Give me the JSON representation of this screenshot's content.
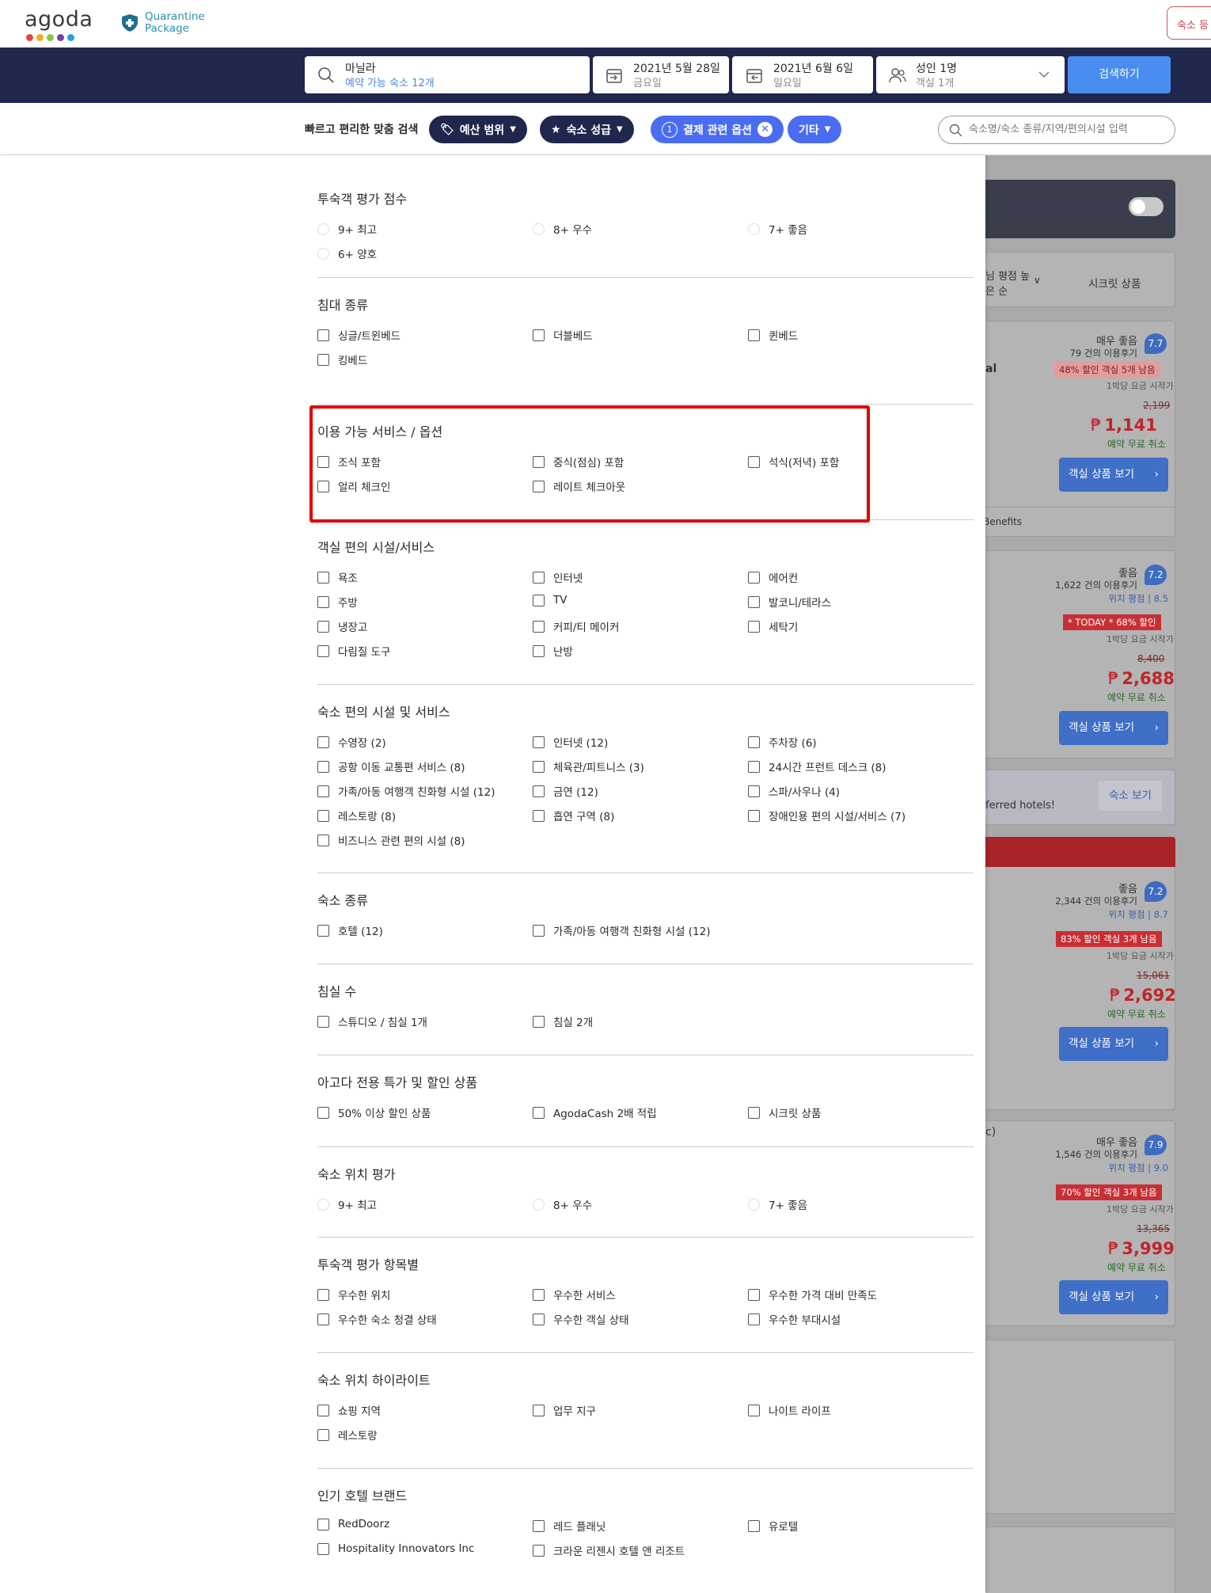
{
  "header": {
    "logo_text": "agoda",
    "logo_dots": [
      "#e64545",
      "#f2a91e",
      "#8cc63e",
      "#7b3fa0",
      "#2a9fd8"
    ],
    "qp_line1": "Quarantine",
    "qp_line2": "Package",
    "list_property": "숙소 등"
  },
  "search": {
    "dest": "마닐라",
    "dest_sub": "예약 가능 숙소 12개",
    "checkin": "2021년 5월 28일",
    "checkin_day": "금요일",
    "checkout": "2021년 6월 6일",
    "checkout_day": "일요일",
    "guests": "성인 1명",
    "rooms": "객실 1개",
    "button": "검색하기"
  },
  "filterbar": {
    "label": "빠르고 편리한 맞춤 검색",
    "budget": "예산 범위",
    "star": "숙소 성급",
    "payment_count": "1",
    "payment": "결제 관련 옵션",
    "other": "기타",
    "placeholder": "숙소명/숙소 종류/지역/편의시설 입력"
  },
  "sections": [
    {
      "title": "투숙객 평가 점수",
      "type": "radio",
      "options": [
        [
          "9+  최고",
          "8+  우수",
          "7+  좋음"
        ],
        [
          "6+  양호"
        ]
      ]
    },
    {
      "title": "침대 종류",
      "type": "check",
      "options": [
        [
          "싱글/트윈베드",
          "더블베드",
          "퀸베드"
        ],
        [
          "킹베드"
        ]
      ]
    },
    {
      "title": "이용 가능 서비스 / 옵션",
      "type": "check",
      "options": [
        [
          "조식 포함",
          "중식(점심) 포함",
          "석식(저녁) 포함"
        ],
        [
          "얼리 체크인",
          "레이트 체크아웃"
        ]
      ]
    },
    {
      "title": "객실 편의 시설/서비스",
      "type": "check",
      "options": [
        [
          "욕조",
          "인터넷",
          "에어컨"
        ],
        [
          "주방",
          "TV",
          "발코니/테라스"
        ],
        [
          "냉장고",
          "커피/티 메이커",
          "세탁기"
        ],
        [
          "다림질 도구",
          "난방"
        ]
      ]
    },
    {
      "title": "숙소 편의 시설 및 서비스",
      "type": "check",
      "options": [
        [
          "수영장 (2)",
          "인터넷 (12)",
          "주차장 (6)"
        ],
        [
          "공항 이동 교통편 서비스 (8)",
          "체육관/피트니스 (3)",
          "24시간 프런트 데스크 (8)"
        ],
        [
          "가족/아동 여행객 친화형 시설 (12)",
          "금연 (12)",
          "스파/사우나 (4)"
        ],
        [
          "레스토랑 (8)",
          "흡연 구역 (8)",
          "장애인용 편의 시설/서비스 (7)"
        ],
        [
          "비즈니스 관련 편의 시설 (8)"
        ]
      ]
    },
    {
      "title": "숙소 종류",
      "type": "check",
      "options": [
        [
          "호텔 (12)",
          "가족/아동 여행객 친화형 시설 (12)"
        ]
      ]
    },
    {
      "title": "침실 수",
      "type": "check",
      "options": [
        [
          "스튜디오 / 침실 1개",
          "침실 2개"
        ]
      ]
    },
    {
      "title": "아고다 전용 특가 및 할인 상품",
      "type": "check",
      "options": [
        [
          "50% 이상 할인 상품",
          "AgodaCash 2배 적립",
          "시크릿 상품"
        ]
      ]
    },
    {
      "title": "숙소 위치 평가",
      "type": "radio",
      "options": [
        [
          "9+  최고",
          "8+  우수",
          "7+  좋음"
        ]
      ]
    },
    {
      "title": "투숙객 평가 항목별",
      "type": "check",
      "options": [
        [
          "우수한 위치",
          "우수한 서비스",
          "우수한 가격 대비 만족도"
        ],
        [
          "우수한 숙소 청결 상태",
          "우수한 객실 상태",
          "우수한 부대시설"
        ]
      ]
    },
    {
      "title": "숙소 위치 하이라이트",
      "type": "check",
      "options": [
        [
          "쇼핑 지역",
          "업무 지구",
          "나이트 라이프"
        ],
        [
          "레스토랑"
        ]
      ]
    },
    {
      "title": "인기 호텔 브랜드",
      "type": "check",
      "options": [
        [
          "RedDoorz",
          "레드 플래닛",
          "유로텔"
        ],
        [
          "Hospitality Innovators Inc",
          "크라운 리젠시 호텔 앤 리조트"
        ]
      ]
    }
  ],
  "right": {
    "sort_label": "평점 높\n은 순",
    "sort_line1": "님 평점 높",
    "sort_line2": "은 순",
    "secret": "시크릿 상품",
    "card1": {
      "word": "매우 좋음",
      "reviews": "79 건의 이용후기",
      "badge": "48% 할인 객실 5개 남음",
      "from": "1박당 요금 시작가",
      "old": "2,199",
      "price": "1,141",
      "free": "예약 무료 취소",
      "score": "7.7",
      "cut": "al"
    },
    "benefits": "Benefits",
    "card2": {
      "word": "좋음",
      "reviews": "1,622 건의 이용후기",
      "loc": "위치 평점 | 8.5",
      "badge": "* TODAY * 68% 할인",
      "from": "1박당 요금 시작가",
      "old": "8,400",
      "price": "2,688",
      "free": "예약 무료 취소",
      "score": "7.2"
    },
    "preferred": "ferred hotels!",
    "view": "숙소 보기",
    "card3": {
      "word": "좋음",
      "reviews": "2,344 건의 이용후기",
      "loc": "위치 평점 | 8.7",
      "badge": "83% 할인 객실 3개 남음",
      "from": "1박당 요금 시작가",
      "old": "15,061",
      "price": "2,692",
      "free": "예약 무료 취소",
      "score": "7.2"
    },
    "card4": {
      "word": "매우 좋음",
      "reviews": "1,546 건의 이용후기",
      "loc": "위치 평점 | 9.0",
      "badge": "70% 할인 객실 3개 남음",
      "from": "1박당 요금 시작가",
      "old": "13,365",
      "price": "3,999",
      "free": "예약 무료 취소",
      "score": "7.9",
      "cut": "c)"
    },
    "room_btn": "객실 상품 보기",
    "peso": "₱"
  }
}
